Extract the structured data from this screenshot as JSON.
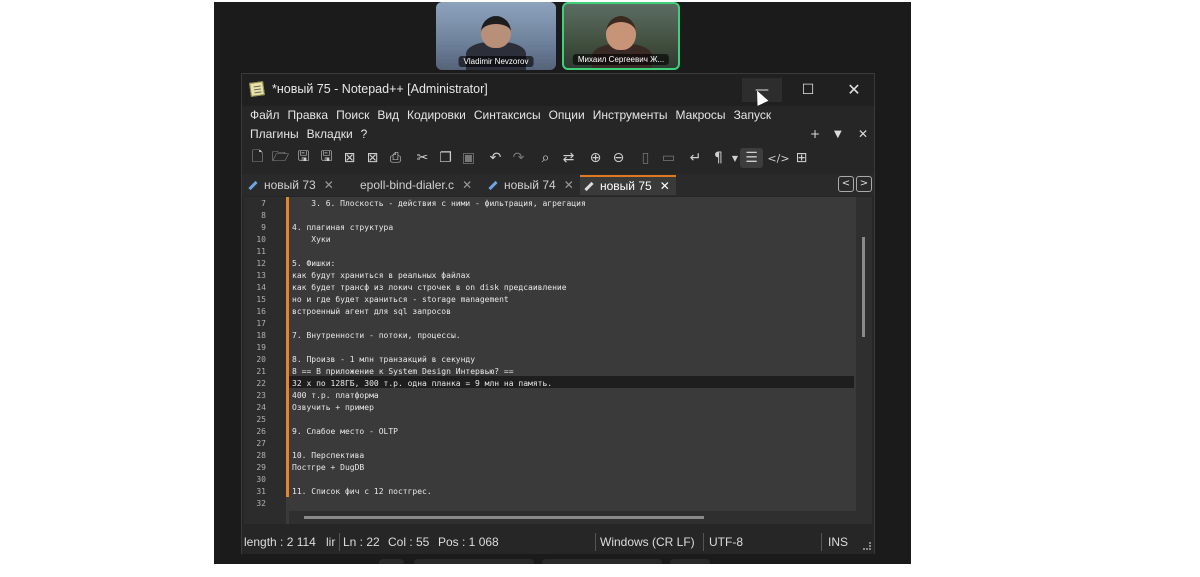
{
  "participants": [
    {
      "name": "Vladimir Nevzorov"
    },
    {
      "name": "Михаил Сергеевич Ж..."
    }
  ],
  "window": {
    "title": "*новый 75 - Notepad++ [Administrator]",
    "minimize": "—",
    "maximize": "☐",
    "close": "✕"
  },
  "menu": {
    "row1": [
      "Файл",
      "Правка",
      "Поиск",
      "Вид",
      "Кодировки",
      "Синтаксисы",
      "Опции",
      "Инструменты",
      "Макросы",
      "Запуск"
    ],
    "row2": [
      "Плагины",
      "Вкладки",
      "?"
    ],
    "plus": "+",
    "dropdown": "▼",
    "close": "✕"
  },
  "toolbar": {
    "icons": [
      "new-file-icon",
      "open-folder-icon",
      "save-icon",
      "save-all-icon",
      "close-icon",
      "close-all-icon",
      "print-icon",
      "cut-icon",
      "copy-icon",
      "paste-icon",
      "undo-icon",
      "redo-icon",
      "find-icon",
      "replace-icon",
      "zoom-in-icon",
      "zoom-out-icon",
      "sync-vertical-icon",
      "sync-horizontal-icon",
      "word-wrap-icon",
      "show-all-chars-icon",
      "dropdown-icon",
      "indent-guide-icon",
      "xml-tag-icon",
      "document-map-icon"
    ]
  },
  "tabs": [
    {
      "label": "новый 73",
      "close": "✕"
    },
    {
      "label": "epoll-bind-dialer.c",
      "close": "✕"
    },
    {
      "label": "новый 74",
      "close": "✕"
    },
    {
      "label": "новый 75",
      "close": "✕"
    }
  ],
  "tab_nav": {
    "prev": "<",
    "next": ">"
  },
  "editor": {
    "lines": [
      {
        "n": "7",
        "text": "    3. 6. Плоскость - действия с ними - фильтрация, агрегация"
      },
      {
        "n": "8",
        "text": ""
      },
      {
        "n": "9",
        "text": "4. плагиная структура"
      },
      {
        "n": "10",
        "text": "    Хуки"
      },
      {
        "n": "11",
        "text": ""
      },
      {
        "n": "12",
        "text": "5. Фишки:"
      },
      {
        "n": "13",
        "text": "как будут храниться в реальных файлах"
      },
      {
        "n": "14",
        "text": "как будет трансф из локич строчек в on disk предсаивление"
      },
      {
        "n": "15",
        "text": "но и где будет храниться - storage management"
      },
      {
        "n": "16",
        "text": "встроенный агент для sql запросов"
      },
      {
        "n": "17",
        "text": ""
      },
      {
        "n": "18",
        "text": "7. Внутренности - потоки, процессы."
      },
      {
        "n": "19",
        "text": ""
      },
      {
        "n": "20",
        "text": "8. Произв - 1 млн транзакций в секунду"
      },
      {
        "n": "21",
        "text": "8 == В приложение к System Design Интервью? =="
      },
      {
        "n": "22",
        "text": "32 x по 128ГБ, 300 т.р. одна планка = 9 млн на память."
      },
      {
        "n": "23",
        "text": "400 т.р. платформа"
      },
      {
        "n": "24",
        "text": "Озвучить + пример"
      },
      {
        "n": "25",
        "text": ""
      },
      {
        "n": "26",
        "text": "9. Слабое место - OLTP"
      },
      {
        "n": "27",
        "text": ""
      },
      {
        "n": "28",
        "text": "10. Перспектива"
      },
      {
        "n": "29",
        "text": "Постгре + DugDB"
      },
      {
        "n": "30",
        "text": ""
      },
      {
        "n": "31",
        "text": "11. Список фич с 12 постгрес."
      },
      {
        "n": "32",
        "text": ""
      }
    ]
  },
  "status": {
    "length": "length : 2 114",
    "lines": "lir",
    "ln": "Ln : 22",
    "col": "Col : 55",
    "pos": "Pos : 1 068",
    "eol": "Windows (CR LF)",
    "encoding": "UTF-8",
    "ins": "INS"
  }
}
